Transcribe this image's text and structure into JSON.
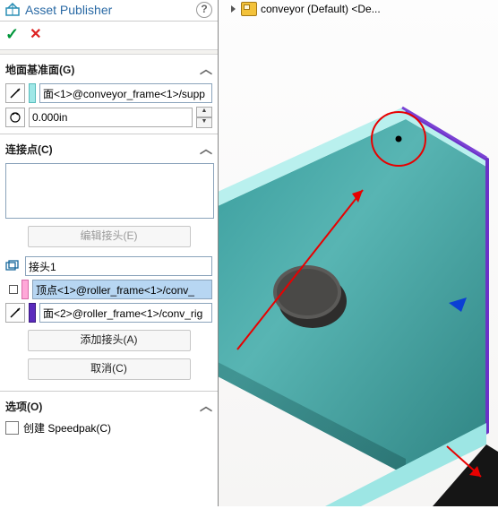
{
  "tree": {
    "label": "conveyor (Default) <De..."
  },
  "header": {
    "title": "Asset Publisher"
  },
  "actions": {
    "ok": "✓",
    "cancel": "✕"
  },
  "ground": {
    "title": "地面基准面(G)",
    "face_value": "面<1>@conveyor_frame<1>/supp",
    "angle_value": "0.000in"
  },
  "connectors": {
    "title": "连接点(C)",
    "edit_btn": "编辑接头(E)",
    "name_value": "接头1",
    "sel1": "顶点<1>@roller_frame<1>/conv_",
    "sel2": "面<2>@roller_frame<1>/conv_rig",
    "add_btn": "添加接头(A)",
    "cancel_btn": "取消(C)"
  },
  "options": {
    "title": "选项(O)",
    "speedpak_label": "创建 Speedpak(C)"
  }
}
